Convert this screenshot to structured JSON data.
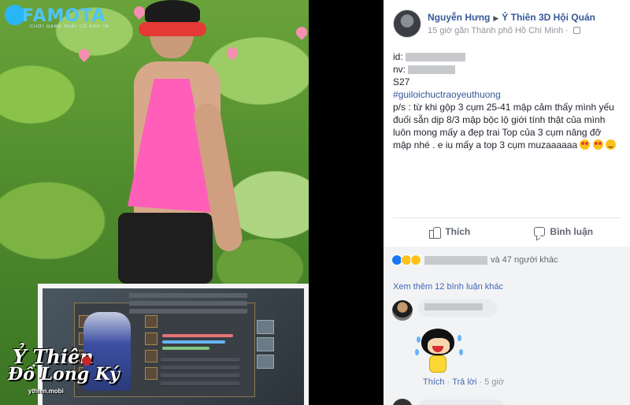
{
  "photo": {
    "watermark_brand": "FAMOTA",
    "watermark_tagline": "CHƠI GAME PHẢI CÓ ANH TA",
    "game_logo_line1": "Ỷ Thiên",
    "game_logo_line2": "Đồ Long Ký",
    "game_logo_site": "ythien.mobi"
  },
  "post": {
    "author_name": "Nguyễn Hưng",
    "arrow": "▶",
    "group_name": "Ỷ Thiên 3D Hội Quán",
    "meta": "15 giờ gần Thành phố Hồ Chí Minh · ",
    "privacy_icon": "group-privacy-icon",
    "lines": {
      "id_label": "id:",
      "nv_label": "nv:",
      "server": "S27",
      "hashtag": "#guiloichuctraoyeuthuong",
      "body": "p/s : từ khi gộp 3 cụm 25-41 mập cảm thấy mình yếu đuối sẵn dịp 8/3 mập bộc lộ giới tính thật của mình luôn mong mấy a đẹp trai Top của 3 cụm nâng đỡ mập nhé . e iu mấy a top 3 cụm muzaaaaaa"
    }
  },
  "actions": {
    "like": "Thích",
    "comment": "Bình luận"
  },
  "reactions": {
    "icons": [
      "like-reaction",
      "haha-reaction",
      "wow-reaction"
    ],
    "others_text": "và 47 người khác"
  },
  "comments": {
    "view_more": "Xem thêm 12 bình luận khác",
    "items": [
      {
        "like_label": "Thích",
        "reply_label": "Trả lời",
        "time": "5 giờ"
      }
    ]
  }
}
